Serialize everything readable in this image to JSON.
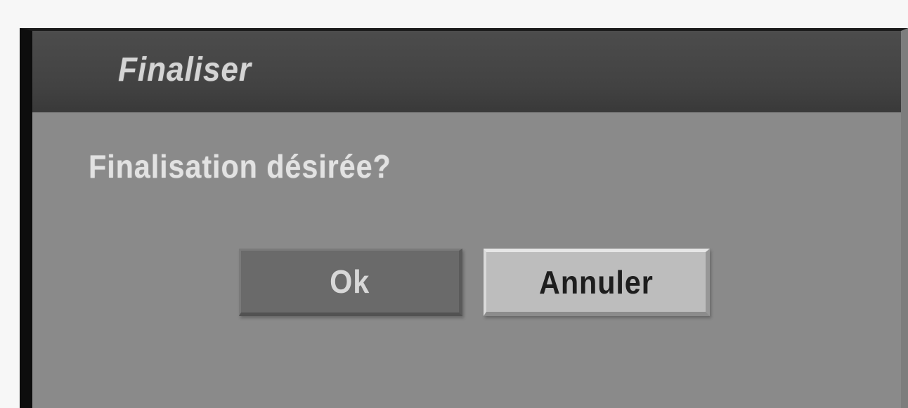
{
  "dialog": {
    "title": "Finaliser",
    "message": "Finalisation désirée?",
    "buttons": {
      "ok_label": "Ok",
      "cancel_label": "Annuler"
    },
    "focused_button": "Annuler"
  },
  "colors": {
    "titlebar": "#444444",
    "dialog_body": "#8a8a8a",
    "ok_button": "#6a6a6a",
    "cancel_button_highlight": "#bdbdbd",
    "text_light": "#e2e2e2"
  }
}
